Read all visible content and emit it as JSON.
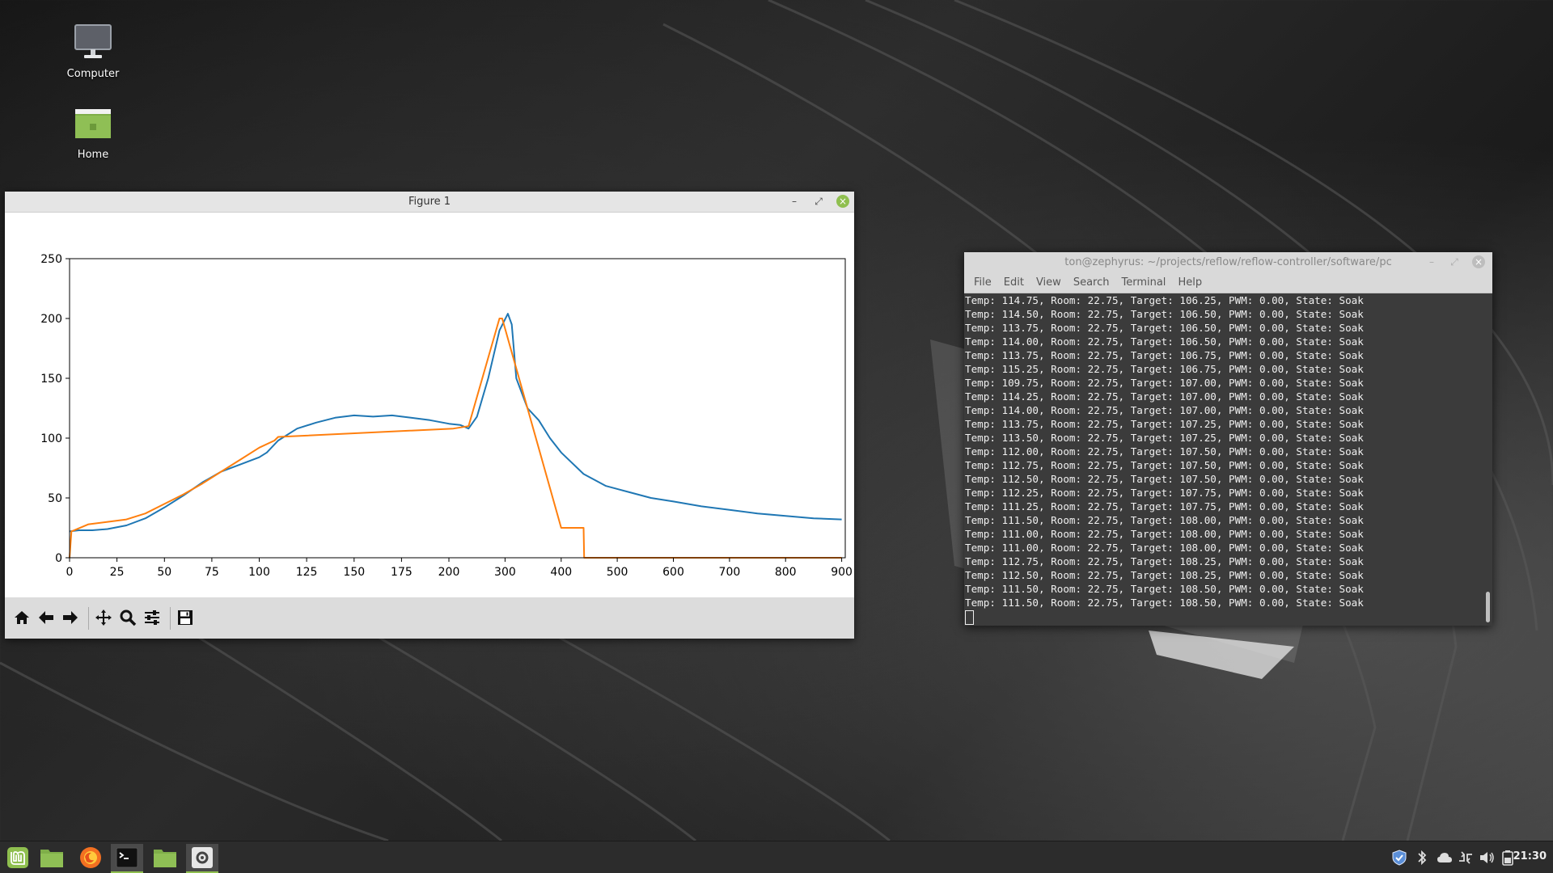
{
  "desktop": {
    "icons": [
      {
        "label": "Computer",
        "icon": "monitor-icon"
      },
      {
        "label": "Home",
        "icon": "folder-icon"
      }
    ]
  },
  "figure_window": {
    "title": "Figure 1",
    "controls": {
      "minimize": "–",
      "maximize": "⤢",
      "close": "×"
    },
    "toolbar": [
      "home-icon",
      "back-arrow-icon",
      "forward-arrow-icon",
      "pan-icon",
      "zoom-icon",
      "configure-subplots-icon",
      "save-icon"
    ]
  },
  "chart_data": {
    "type": "line",
    "xlabel": "",
    "ylabel": "",
    "ylim": [
      0,
      250
    ],
    "y_ticks": [
      "0",
      "50",
      "100",
      "150",
      "200",
      "250"
    ],
    "x_ticks": [
      "0",
      "25",
      "50",
      "75",
      "100",
      "125",
      "150",
      "175",
      "200",
      "300",
      "400",
      "500",
      "600",
      "700",
      "800",
      "900"
    ],
    "x_tick_values": [
      0,
      25,
      50,
      75,
      100,
      125,
      150,
      175,
      200,
      300,
      400,
      500,
      600,
      700,
      800,
      900
    ],
    "grid": false,
    "series": [
      {
        "color": "#1f77b4",
        "points": [
          [
            0,
            22
          ],
          [
            5,
            23
          ],
          [
            12,
            23
          ],
          [
            20,
            24
          ],
          [
            30,
            27
          ],
          [
            40,
            33
          ],
          [
            50,
            42
          ],
          [
            60,
            52
          ],
          [
            70,
            63
          ],
          [
            80,
            72
          ],
          [
            90,
            78
          ],
          [
            100,
            84
          ],
          [
            104,
            88
          ],
          [
            110,
            98
          ],
          [
            120,
            108
          ],
          [
            130,
            113
          ],
          [
            140,
            117
          ],
          [
            150,
            119
          ],
          [
            160,
            118
          ],
          [
            170,
            119
          ],
          [
            180,
            117
          ],
          [
            190,
            115
          ],
          [
            200,
            112
          ],
          [
            220,
            111
          ],
          [
            235,
            108
          ],
          [
            250,
            118
          ],
          [
            270,
            150
          ],
          [
            290,
            190
          ],
          [
            305,
            204
          ],
          [
            312,
            195
          ],
          [
            320,
            150
          ],
          [
            340,
            125
          ],
          [
            360,
            115
          ],
          [
            380,
            100
          ],
          [
            400,
            88
          ],
          [
            440,
            70
          ],
          [
            480,
            60
          ],
          [
            520,
            55
          ],
          [
            560,
            50
          ],
          [
            600,
            47
          ],
          [
            650,
            43
          ],
          [
            700,
            40
          ],
          [
            750,
            37
          ],
          [
            800,
            35
          ],
          [
            850,
            33
          ],
          [
            900,
            32
          ]
        ]
      },
      {
        "color": "#ff7f0e",
        "points": [
          [
            0,
            0
          ],
          [
            1,
            22
          ],
          [
            10,
            28
          ],
          [
            20,
            30
          ],
          [
            30,
            32
          ],
          [
            40,
            37
          ],
          [
            50,
            45
          ],
          [
            60,
            53
          ],
          [
            70,
            62
          ],
          [
            80,
            72
          ],
          [
            90,
            82
          ],
          [
            100,
            92
          ],
          [
            108,
            98
          ],
          [
            110,
            101
          ],
          [
            208,
            108
          ],
          [
            235,
            110
          ],
          [
            290,
            200
          ],
          [
            295,
            200
          ],
          [
            400,
            25
          ],
          [
            440,
            25
          ],
          [
            441,
            0
          ],
          [
            900,
            0
          ]
        ]
      }
    ]
  },
  "terminal": {
    "title": "ton@zephyrus: ~/projects/reflow/reflow-controller/software/pc",
    "menu": [
      "File",
      "Edit",
      "View",
      "Search",
      "Terminal",
      "Help"
    ],
    "lines": [
      "Temp: 114.75, Room: 22.75, Target: 106.25, PWM: 0.00, State: Soak",
      "Temp: 114.50, Room: 22.75, Target: 106.50, PWM: 0.00, State: Soak",
      "Temp: 113.75, Room: 22.75, Target: 106.50, PWM: 0.00, State: Soak",
      "Temp: 114.00, Room: 22.75, Target: 106.50, PWM: 0.00, State: Soak",
      "Temp: 113.75, Room: 22.75, Target: 106.75, PWM: 0.00, State: Soak",
      "Temp: 115.25, Room: 22.75, Target: 106.75, PWM: 0.00, State: Soak",
      "Temp: 109.75, Room: 22.75, Target: 107.00, PWM: 0.00, State: Soak",
      "Temp: 114.25, Room: 22.75, Target: 107.00, PWM: 0.00, State: Soak",
      "Temp: 114.00, Room: 22.75, Target: 107.00, PWM: 0.00, State: Soak",
      "Temp: 113.75, Room: 22.75, Target: 107.25, PWM: 0.00, State: Soak",
      "Temp: 113.50, Room: 22.75, Target: 107.25, PWM: 0.00, State: Soak",
      "Temp: 112.00, Room: 22.75, Target: 107.50, PWM: 0.00, State: Soak",
      "Temp: 112.75, Room: 22.75, Target: 107.50, PWM: 0.00, State: Soak",
      "Temp: 112.50, Room: 22.75, Target: 107.50, PWM: 0.00, State: Soak",
      "Temp: 112.25, Room: 22.75, Target: 107.75, PWM: 0.00, State: Soak",
      "Temp: 111.25, Room: 22.75, Target: 107.75, PWM: 0.00, State: Soak",
      "Temp: 111.50, Room: 22.75, Target: 108.00, PWM: 0.00, State: Soak",
      "Temp: 111.00, Room: 22.75, Target: 108.00, PWM: 0.00, State: Soak",
      "Temp: 111.00, Room: 22.75, Target: 108.00, PWM: 0.00, State: Soak",
      "Temp: 112.75, Room: 22.75, Target: 108.25, PWM: 0.00, State: Soak",
      "Temp: 112.50, Room: 22.75, Target: 108.25, PWM: 0.00, State: Soak",
      "Temp: 111.50, Room: 22.75, Target: 108.50, PWM: 0.00, State: Soak",
      "Temp: 111.50, Room: 22.75, Target: 108.50, PWM: 0.00, State: Soak"
    ]
  },
  "taskbar": {
    "apps": [
      "mint-menu-icon",
      "show-desktop-icon",
      "firefox-icon",
      "terminal-icon",
      "files-icon",
      "figure-app-icon"
    ],
    "tray": [
      "shield-icon",
      "bluetooth-icon",
      "cloud-icon",
      "network-icon",
      "volume-icon",
      "battery-icon"
    ],
    "clock": "21:30",
    "accent": "#8fbf4f"
  }
}
